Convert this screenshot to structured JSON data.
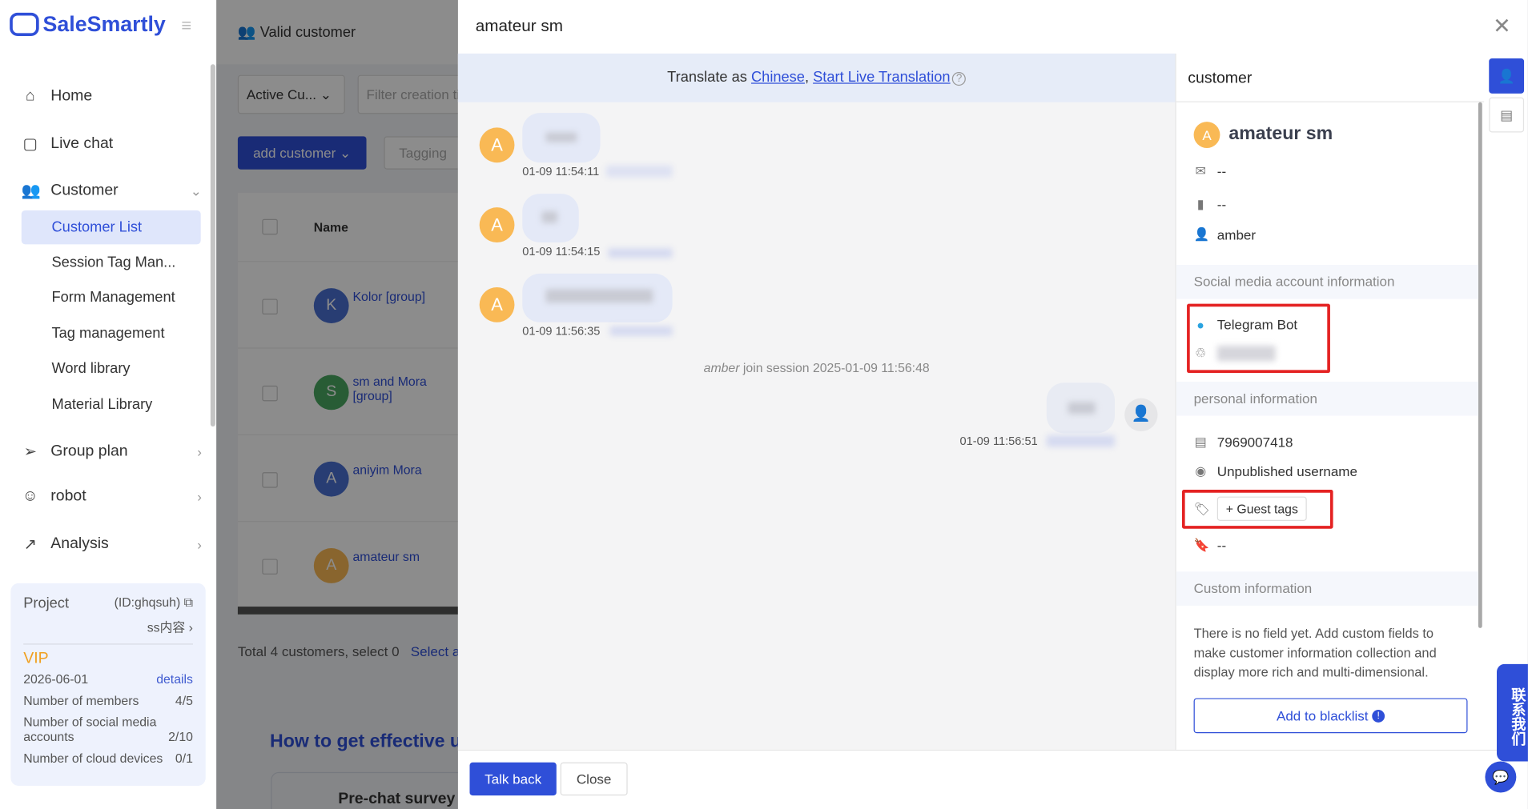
{
  "app": {
    "brand": "SaleSmartly"
  },
  "sidebar": {
    "items": [
      {
        "label": "Home",
        "icon": "home-icon"
      },
      {
        "label": "Live chat",
        "icon": "chat-icon"
      },
      {
        "label": "Customer",
        "icon": "users-icon"
      },
      {
        "label": "Group plan",
        "icon": "send-icon"
      },
      {
        "label": "robot",
        "icon": "robot-icon"
      },
      {
        "label": "Analysis",
        "icon": "chart-icon"
      }
    ],
    "sub_items": [
      "Customer List",
      "Session Tag Man...",
      "Form Management",
      "Tag management",
      "Word library",
      "Material Library"
    ],
    "project": {
      "label": "Project",
      "id": "(ID:ghqsuh)",
      "name": "ss内容",
      "plan": "VIP",
      "expiry": "2026-06-01",
      "details": "details",
      "stats": [
        {
          "label": "Number of members",
          "value": "4/5"
        },
        {
          "label": "Number of social media accounts",
          "value": "2/10"
        },
        {
          "label": "Number of cloud devices",
          "value": "0/1"
        }
      ]
    }
  },
  "background": {
    "title": "Valid customer",
    "filter_select": "Active Cu...",
    "filter_placeholder": "Filter creation ti",
    "add_customer": "add customer",
    "tagging": "Tagging",
    "col_name": "Name",
    "rows": [
      {
        "initial": "K",
        "name": "Kolor [group]",
        "color": "#4a6fd1"
      },
      {
        "initial": "S",
        "name": "sm and Mora [group]",
        "color": "#4aa862"
      },
      {
        "initial": "A",
        "name": "aniyim Mora",
        "color": "#4a6fd1"
      },
      {
        "initial": "A",
        "name": "amateur sm",
        "color": "#f9b955"
      }
    ],
    "total": "Total 4 customers, select 0",
    "select_all": "Select all",
    "how_to": "How to get effective us",
    "survey": "Pre-chat survey"
  },
  "modal": {
    "title": "amateur sm",
    "translate_prefix": "Translate as ",
    "translate_lang": "Chinese",
    "translate_sep": ", ",
    "live_translation": "Start Live Translation",
    "messages": [
      {
        "initial": "A",
        "time": "01-09 11:54:11"
      },
      {
        "initial": "A",
        "time": "01-09 11:54:15"
      },
      {
        "initial": "A",
        "time": "01-09 11:56:35"
      }
    ],
    "join_agent": "amber",
    "join_text": " join session 2025-01-09 11:56:48",
    "reply_time": "01-09 11:56:51",
    "talk_back": "Talk back",
    "close": "Close"
  },
  "customer": {
    "header": "customer",
    "initial": "A",
    "name": "amateur sm",
    "email": "--",
    "phone": "--",
    "owner": "amber",
    "social_header": "Social media account information",
    "platform": "Telegram Bot",
    "personal_header": "personal information",
    "user_id": "7969007418",
    "username": "Unpublished username",
    "guest_tags": "Guest tags",
    "bookmark": "--",
    "custom_header": "Custom information",
    "custom_empty": "There is no field yet. Add custom fields to make customer information collection and display more rich and multi-dimensional.",
    "blacklist": "Add to blacklist"
  },
  "contact": {
    "label": "联系我们"
  },
  "colors": {
    "brand": "#2f4fd8",
    "highlight": "#e42222",
    "vip": "#f0a020"
  }
}
